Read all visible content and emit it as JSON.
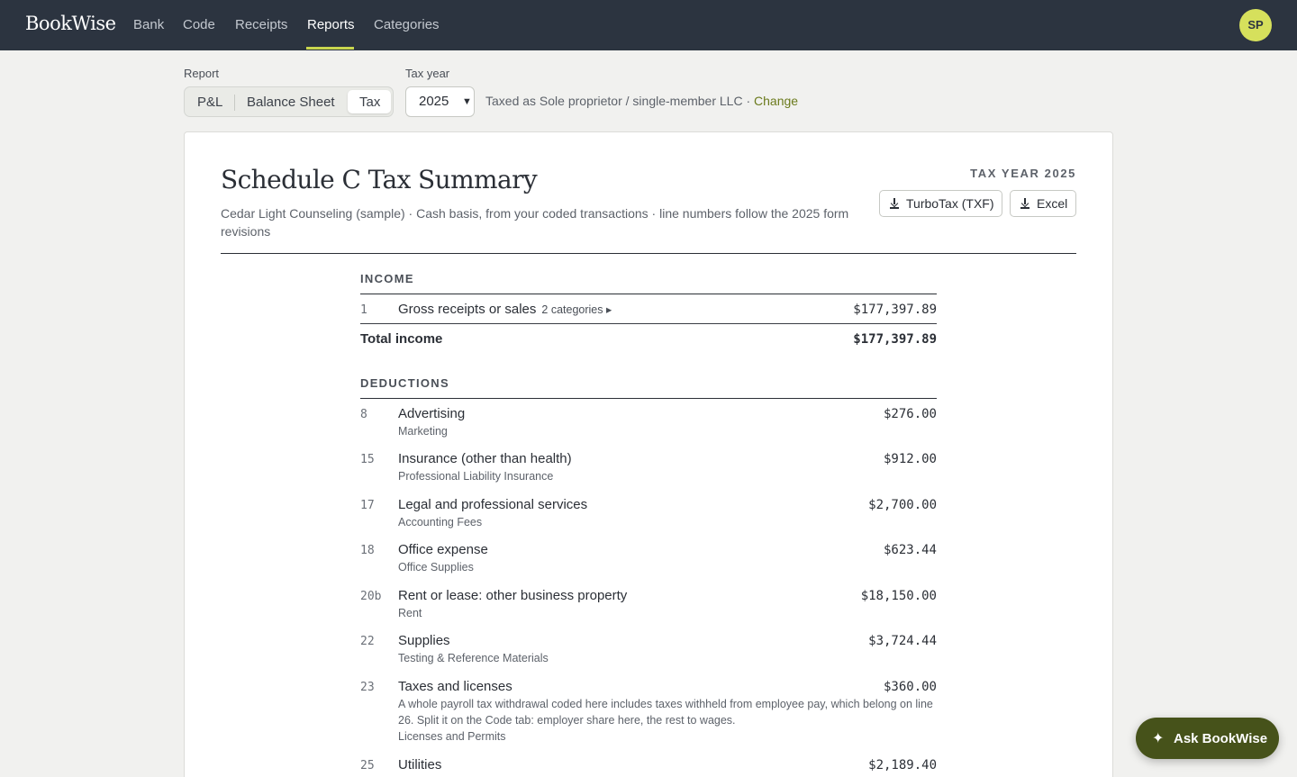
{
  "nav": {
    "logo": "BookWise",
    "items": [
      {
        "label": "Bank"
      },
      {
        "label": "Code"
      },
      {
        "label": "Receipts"
      },
      {
        "label": "Reports",
        "active": true
      },
      {
        "label": "Categories"
      }
    ],
    "avatar_initials": "SP"
  },
  "controls": {
    "report_label": "Report",
    "report_tabs": [
      {
        "label": "P&L"
      },
      {
        "label": "Balance Sheet"
      },
      {
        "label": "Tax",
        "active": true
      }
    ],
    "tax_year_label": "Tax year",
    "tax_year_value": "2025",
    "taxed_as": "Taxed as Sole proprietor / single-member LLC ·",
    "change_link": "Change"
  },
  "report": {
    "title": "Schedule C Tax Summary",
    "subtitle": "Cedar Light Counseling (sample) · Cash basis, from your coded transactions · line numbers follow the 2025 form revisions",
    "tax_year_tag": "TAX YEAR 2025",
    "export_buttons": [
      {
        "label": "TurboTax (TXF)",
        "icon": "download-icon"
      },
      {
        "label": "Excel",
        "icon": "download-icon"
      }
    ],
    "income": {
      "heading": "INCOME",
      "rows": [
        {
          "line": "1",
          "label": "Gross receipts or sales",
          "categories_link": "2 categories ▸",
          "amount": "$177,397.89"
        }
      ],
      "total_label": "Total income",
      "total_amount": "$177,397.89"
    },
    "deductions": {
      "heading": "DEDUCTIONS",
      "rows": [
        {
          "line": "8",
          "label": "Advertising",
          "sub": "Marketing",
          "amount": "$276.00"
        },
        {
          "line": "15",
          "label": "Insurance (other than health)",
          "sub": "Professional Liability Insurance",
          "amount": "$912.00"
        },
        {
          "line": "17",
          "label": "Legal and professional services",
          "sub": "Accounting Fees",
          "amount": "$2,700.00"
        },
        {
          "line": "18",
          "label": "Office expense",
          "sub": "Office Supplies",
          "amount": "$623.44"
        },
        {
          "line": "20b",
          "label": "Rent or lease: other business property",
          "sub": "Rent",
          "amount": "$18,150.00"
        },
        {
          "line": "22",
          "label": "Supplies",
          "sub": "Testing & Reference Materials",
          "amount": "$3,724.44"
        },
        {
          "line": "23",
          "label": "Taxes and licenses",
          "note": "A whole payroll tax withdrawal coded here includes taxes withheld from employee pay, which belong on line 26. Split it on the Code tab: employer share here, the rest to wages.",
          "sub": "Licenses and Permits",
          "amount": "$360.00"
        },
        {
          "line": "25",
          "label": "Utilities",
          "sub": "",
          "amount": "$2,189.40"
        }
      ]
    }
  },
  "assistant": {
    "label": "Ask BookWise",
    "icon": "sparkle-icon"
  }
}
